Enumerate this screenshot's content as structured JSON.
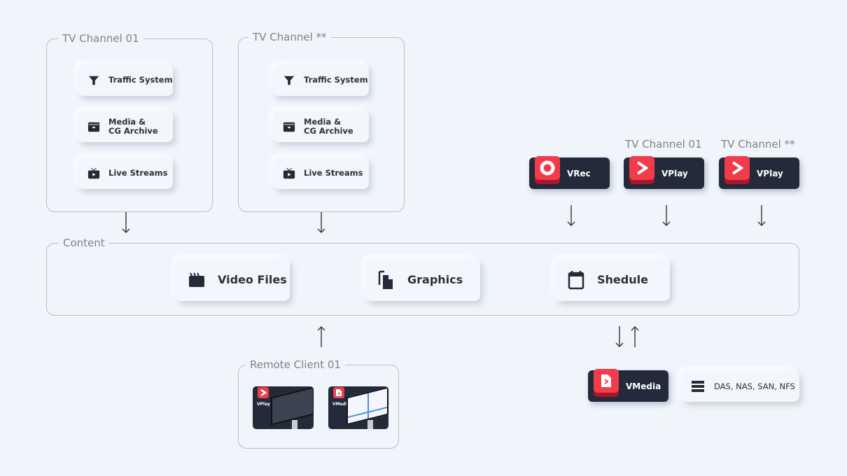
{
  "groups": {
    "channel1": {
      "title": "TV Channel 01",
      "items": [
        {
          "label": "Traffic System",
          "icon": "filter-icon"
        },
        {
          "label": "Media & CG Archive",
          "icon": "archive-icon"
        },
        {
          "label": "Live Streams",
          "icon": "tv-icon"
        }
      ]
    },
    "channel2": {
      "title": "TV Channel **",
      "items": [
        {
          "label": "Traffic System",
          "icon": "filter-icon"
        },
        {
          "label": "Media & CG Archive",
          "icon": "archive-icon"
        },
        {
          "label": "Live Streams",
          "icon": "tv-icon"
        }
      ]
    },
    "content": {
      "title": "Content",
      "items": [
        {
          "label": "Video Files",
          "icon": "clapperboard-icon"
        },
        {
          "label": "Graphics",
          "icon": "files-icon"
        },
        {
          "label": "Shedule",
          "icon": "calendar-icon"
        }
      ]
    },
    "remote": {
      "title": "Remote Client 01",
      "apps": [
        {
          "label": "VPlay"
        },
        {
          "label": "VMedia"
        }
      ]
    }
  },
  "apps": {
    "vrec": {
      "label": "VRec"
    },
    "vplay1": {
      "label": "VPlay",
      "channel": "TV Channel 01"
    },
    "vplay2": {
      "label": "VPlay",
      "channel": "TV Channel **"
    },
    "vmedia": {
      "label": "VMedia"
    },
    "storage": {
      "label": "DAS, NAS, SAN, NFS",
      "icon": "server-icon"
    }
  },
  "colors": {
    "accent": "#f23c4c",
    "dark": "#232b3a",
    "background": "#f0f4fb"
  }
}
